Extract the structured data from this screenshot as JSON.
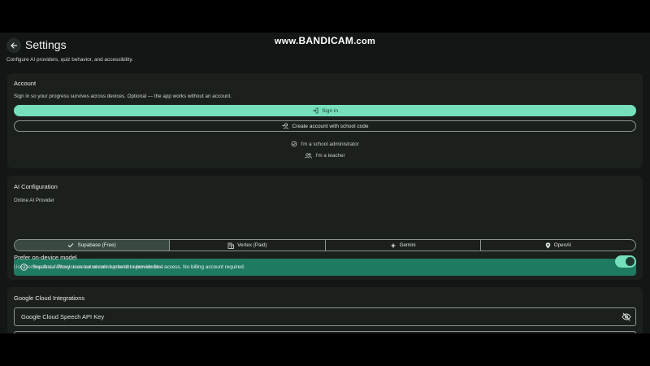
{
  "watermark": {
    "prefix": "www.",
    "brand": "BANDICAM",
    "suffix": ".com"
  },
  "header": {
    "title": "Settings",
    "subtitle": "Configure AI providers, quiz behavior, and accessibility."
  },
  "account": {
    "title": "Account",
    "description": "Sign in so your progress survives across devices. Optional — the app works without an account.",
    "signin_label": "Sign in",
    "create_label": "Create account with school code",
    "admin_label": "I'm a school administrator",
    "teacher_label": "I'm a teacher"
  },
  "ai": {
    "title": "AI Configuration",
    "provider_label": "Online AI Provider",
    "providers": [
      {
        "label": "Supabase (Free)",
        "icon": "check-icon",
        "selected": true
      },
      {
        "label": "Vertex (Paid)",
        "icon": "building-icon",
        "selected": false
      },
      {
        "label": "Gemini",
        "icon": "sparkle-icon",
        "selected": false
      },
      {
        "label": "OpenAI",
        "icon": "location-pin-icon",
        "selected": false
      }
    ],
    "info_text": "Supabase Proxy uses our secure backend to provide free access. No billing account required.",
    "prefer_title": "Prefer on-device model",
    "prefer_desc": "Use Gemma first, fallback to selected online provider when needed",
    "prefer_enabled": true
  },
  "gcloud": {
    "title": "Google Cloud Integrations",
    "speech_placeholder": "Google Cloud Speech API Key"
  },
  "colors": {
    "accent": "#76e0bd",
    "info_bg": "#1f7a62",
    "card_bg": "#1b201d",
    "page_bg": "#121614"
  }
}
